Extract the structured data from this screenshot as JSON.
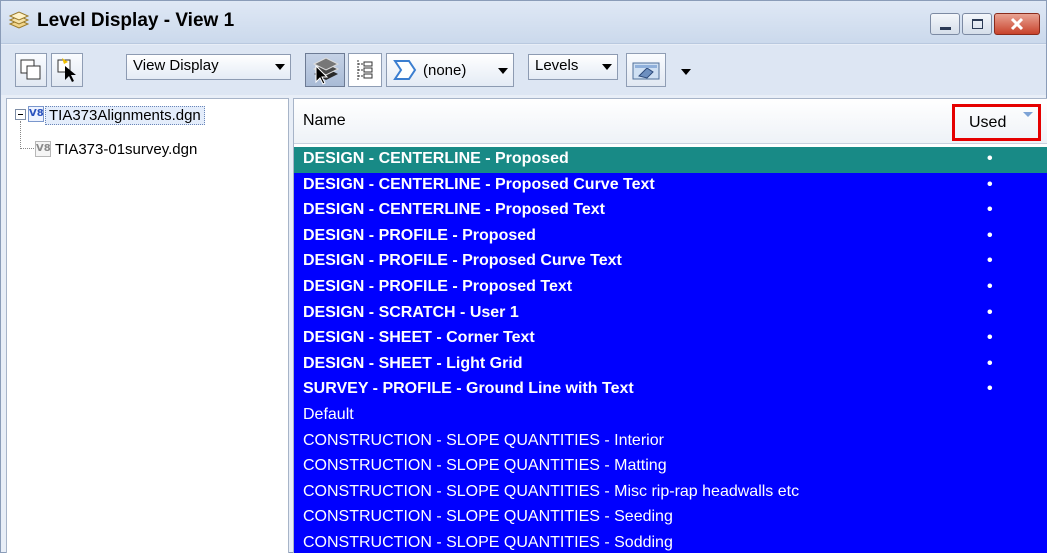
{
  "window": {
    "title": "Level Display - View 1",
    "icon": "level-display-icon"
  },
  "toolbar": {
    "view_display_label": "View Display",
    "filter_label": "(none)",
    "levels_label": "Levels",
    "icons": [
      "copy-view-icon",
      "select-view-icon",
      "view-display-arrow-icon",
      "levels-stack-icon",
      "tree-view-icon",
      "filter-icon",
      "level-manager-icon"
    ]
  },
  "tree": {
    "root": "TIA373Alignments.dgn",
    "child": "TIA373-01survey.dgn"
  },
  "table": {
    "col_name": "Name",
    "col_used": "Used",
    "used_marker": "•",
    "rows": [
      {
        "name": "DESIGN - CENTERLINE - Proposed",
        "used": true
      },
      {
        "name": "DESIGN - CENTERLINE - Proposed Curve Text",
        "used": true
      },
      {
        "name": "DESIGN - CENTERLINE - Proposed Text",
        "used": true
      },
      {
        "name": "DESIGN - PROFILE - Proposed",
        "used": true
      },
      {
        "name": "DESIGN - PROFILE - Proposed Curve Text",
        "used": true
      },
      {
        "name": "DESIGN - PROFILE - Proposed Text",
        "used": true
      },
      {
        "name": "DESIGN - SCRATCH - User 1",
        "used": true
      },
      {
        "name": "DESIGN - SHEET - Corner Text",
        "used": true
      },
      {
        "name": "DESIGN - SHEET - Light Grid",
        "used": true
      },
      {
        "name": "SURVEY - PROFILE - Ground Line with Text",
        "used": true
      },
      {
        "name": "Default",
        "used": false
      },
      {
        "name": "CONSTRUCTION - SLOPE QUANTITIES - Interior",
        "used": false
      },
      {
        "name": "CONSTRUCTION - SLOPE QUANTITIES - Matting",
        "used": false
      },
      {
        "name": "CONSTRUCTION - SLOPE QUANTITIES - Misc rip-rap headwalls etc",
        "used": false
      },
      {
        "name": "CONSTRUCTION - SLOPE QUANTITIES - Seeding",
        "used": false
      },
      {
        "name": "CONSTRUCTION - SLOPE QUANTITIES - Sodding",
        "used": false
      }
    ]
  },
  "colors": {
    "row_selected": "#0000ff",
    "row_focused": "#188a86",
    "highlight_box": "#e50000"
  }
}
